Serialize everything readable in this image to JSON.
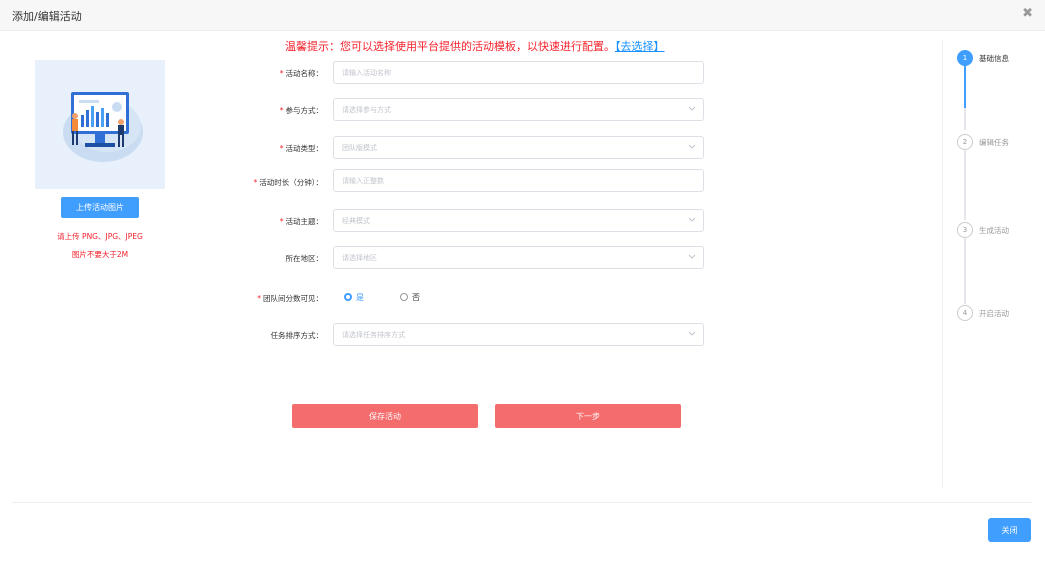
{
  "dialog": {
    "title": "添加/编辑活动",
    "close_icon": "close-icon"
  },
  "tip": {
    "text": "温馨提示：您可以选择使用平台提供的活动模板，以快速进行配置。",
    "link": "【去选择】"
  },
  "upload": {
    "button_label": "上传活动图片",
    "hint_format": "请上传 PNG、JPG、JPEG",
    "hint_size": "图片不要大于2M"
  },
  "form": {
    "fields": [
      {
        "label": "活动名称：",
        "required": true,
        "type": "input",
        "placeholder": "请输入活动名称"
      },
      {
        "label": "参与方式：",
        "required": true,
        "type": "select",
        "placeholder": "请选择参与方式"
      },
      {
        "label": "活动类型：",
        "required": true,
        "type": "select",
        "placeholder": "团队版模式"
      },
      {
        "label": "活动时长（分钟）：",
        "required": true,
        "type": "input",
        "placeholder": "请输入正整数"
      },
      {
        "label": "活动主题：",
        "required": true,
        "type": "select",
        "placeholder": "经典模式"
      },
      {
        "label": "所在地区：",
        "required": false,
        "type": "select",
        "placeholder": "请选择地区"
      },
      {
        "label": "团队间分数可见：",
        "required": true,
        "type": "radio"
      },
      {
        "label": "任务排序方式：",
        "required": false,
        "type": "select",
        "placeholder": "请选择任务排序方式"
      }
    ],
    "radio_options": [
      {
        "label": "是",
        "selected": true
      },
      {
        "label": "否",
        "selected": false
      }
    ]
  },
  "actions": {
    "save_label": "保存活动",
    "next_label": "下一步"
  },
  "steps": [
    {
      "number": "1",
      "label": "基础信息",
      "active": true
    },
    {
      "number": "2",
      "label": "编辑任务",
      "active": false
    },
    {
      "number": "3",
      "label": "生成活动",
      "active": false
    },
    {
      "number": "4",
      "label": "开启活动",
      "active": false
    }
  ],
  "footer": {
    "close_label": "关闭"
  },
  "colors": {
    "primary": "#409eff",
    "danger": "#f5222d",
    "coral": "#f56c6c"
  }
}
